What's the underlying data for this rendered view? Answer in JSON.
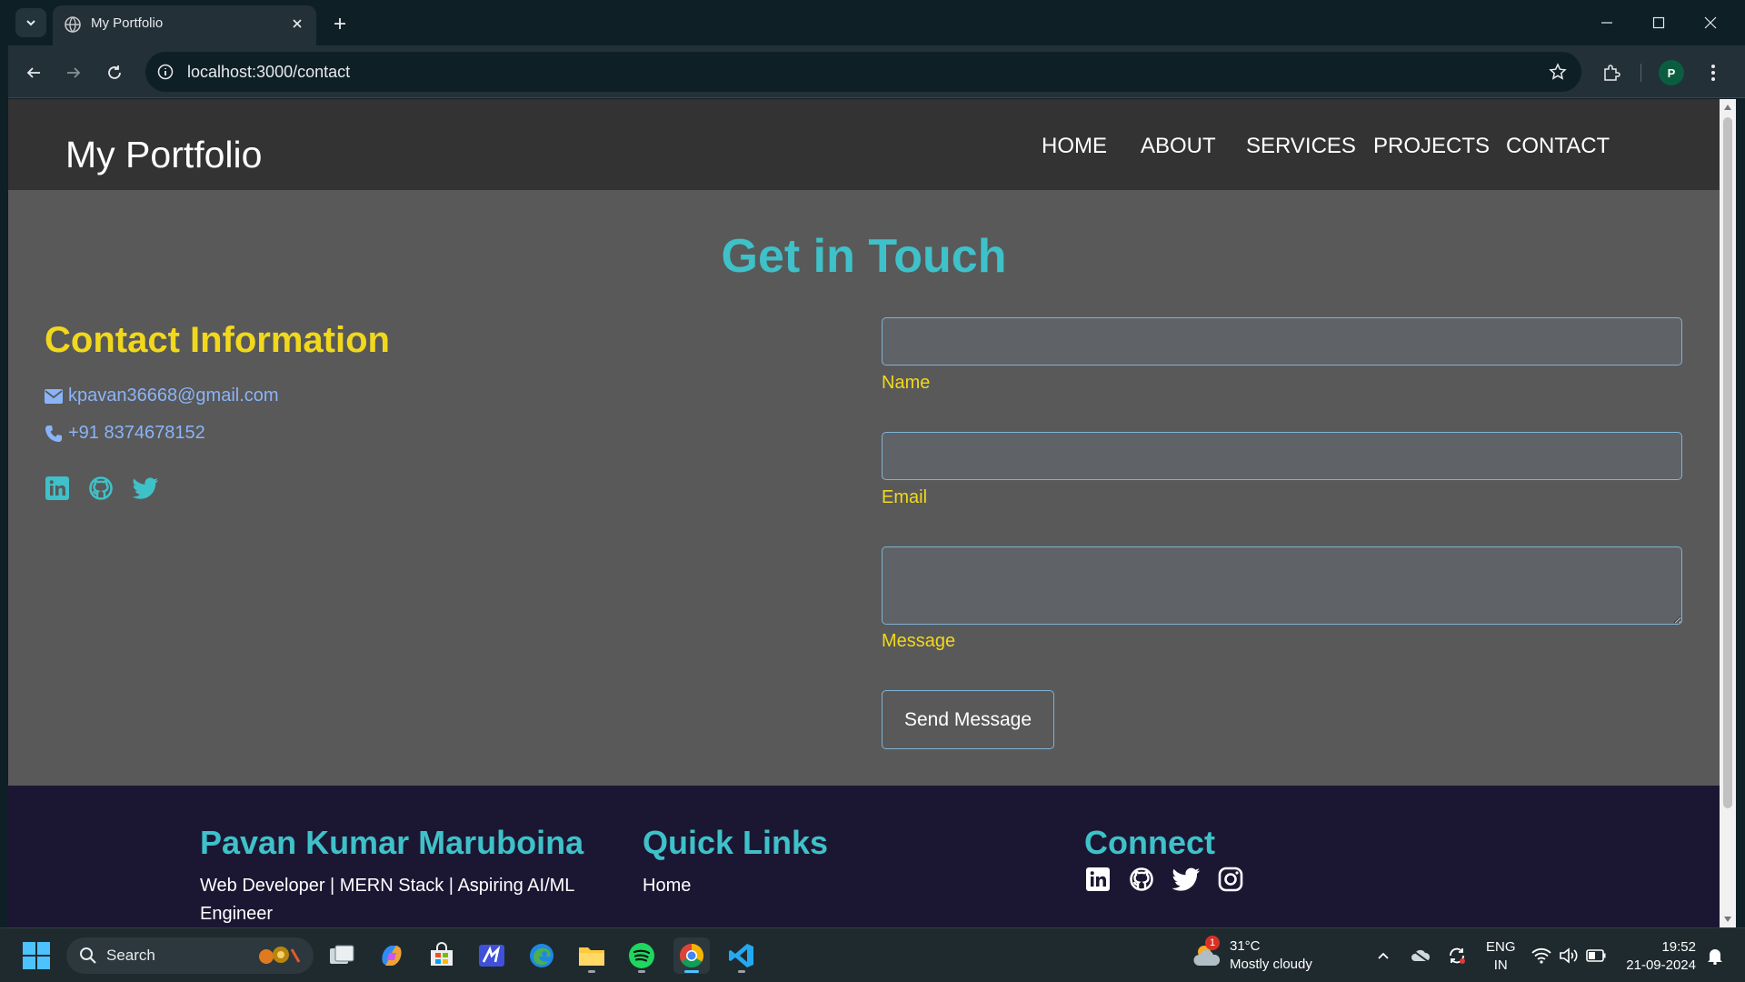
{
  "browser": {
    "tab_title": "My Portfolio",
    "url": "localhost:3000/contact",
    "profile_initial": "P"
  },
  "site": {
    "brand": "My Portfolio",
    "nav": [
      "HOME",
      "ABOUT",
      "SERVICES",
      "PROJECTS",
      "CONTACT"
    ]
  },
  "contact": {
    "heading": "Get in Touch",
    "info_title": "Contact Information",
    "email": "kpavan36668@gmail.com",
    "phone": "+91 8374678152",
    "socials": [
      "linkedin-icon",
      "github-icon",
      "twitter-icon"
    ]
  },
  "form": {
    "name_label": "Name",
    "name_value": "",
    "email_label": "Email",
    "email_value": "",
    "message_label": "Message",
    "message_value": "",
    "submit_label": "Send Message"
  },
  "footer": {
    "owner_name": "Pavan Kumar Maruboina",
    "tagline": "Web Developer | MERN Stack | Aspiring AI/ML Engineer",
    "quick_links_title": "Quick Links",
    "quick_links": [
      "Home"
    ],
    "connect_title": "Connect",
    "socials": [
      "linkedin-icon",
      "github-icon",
      "twitter-icon",
      "instagram-icon"
    ]
  },
  "taskbar": {
    "search_label": "Search",
    "weather_temp": "31°C",
    "weather_desc": "Mostly cloudy",
    "weather_badge": "1",
    "lang_top": "ENG",
    "lang_bottom": "IN",
    "time": "19:52",
    "date": "21-09-2024"
  },
  "colors": {
    "accent_teal": "#3fc1c9",
    "accent_yellow": "#f2d81c",
    "page_bg": "#595959",
    "header_bg": "#333333",
    "footer_bg": "#1b1733"
  }
}
